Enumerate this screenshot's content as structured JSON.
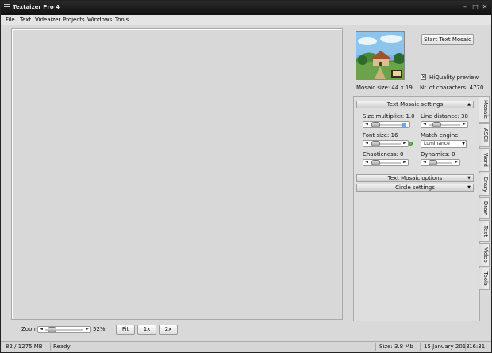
{
  "window": {
    "title": "Textaizer Pro 4"
  },
  "menu": {
    "items": [
      "File",
      "Text",
      "Videaizer",
      "Projects",
      "Windows",
      "Tools"
    ]
  },
  "zoom": {
    "label": "Zoom",
    "value_label": "52%",
    "value": 0.52,
    "buttons": {
      "fit": "Fit",
      "one_x": "1x",
      "two_x": "2x"
    }
  },
  "preview": {
    "start_button": "Start Text Mosaic",
    "hiquality_label": "HiQuality preview",
    "hiquality_checked": true,
    "mosaic_size": "Mosaic size: 44 x 19",
    "char_count": "Nr. of characters: 4770"
  },
  "settings": {
    "header": "Text Mosaic settings",
    "size_multiplier": {
      "label": "Size multiplier: 1.0",
      "value": 0.25
    },
    "line_distance": {
      "label": "Line distance: 38",
      "value": 0.3
    },
    "font_size": {
      "label": "Font size: 16",
      "value": 0.2
    },
    "match_engine": {
      "label": "Match engine",
      "selected": "Luminance"
    },
    "chaoticness": {
      "label": "Chaoticness: 0",
      "value": 0.25
    },
    "dynamics": {
      "label": "Dynamics: 0",
      "value": 0.25
    },
    "options_header": "Text Mosaic options",
    "circle_header": "Circle settings"
  },
  "tabs": [
    "Mosaic",
    "ASCII",
    "Word",
    "Crazy",
    "Draw",
    "Text",
    "Video",
    "Tools"
  ],
  "status": {
    "memory": "82 / 1275 MB",
    "state": "Ready",
    "size": "Size: 3.8 Mb",
    "date": "15 January 2013",
    "time": "16:31"
  }
}
